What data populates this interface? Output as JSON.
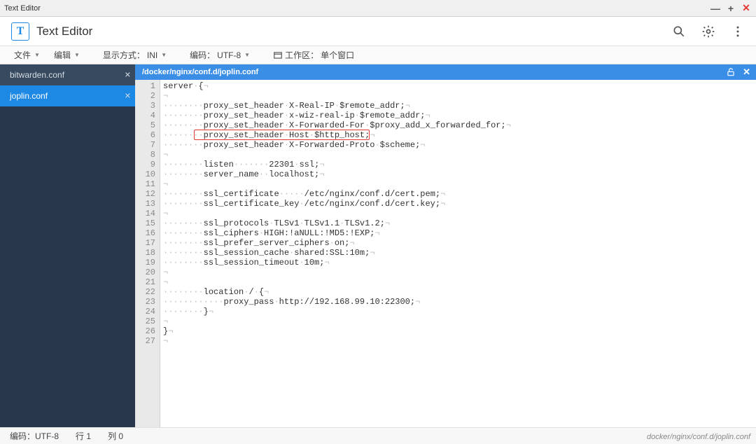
{
  "window": {
    "title": "Text Editor"
  },
  "app": {
    "title": "Text Editor",
    "logo_letter": "T"
  },
  "toolbar": {
    "file": "文件",
    "edit": "编辑",
    "view_label": "显示方式：",
    "view_value": "INI",
    "encoding_label": "编码：",
    "encoding_value": "UTF-8",
    "workspace_label": "工作区：",
    "workspace_value": "单个窗口"
  },
  "sidebar": {
    "tabs": [
      {
        "name": "bitwarden.conf",
        "active": false
      },
      {
        "name": "joplin.conf",
        "active": true
      }
    ]
  },
  "filebar": {
    "path": "/docker/nginx/conf.d/joplin.conf"
  },
  "code": {
    "lines": [
      "server {",
      "",
      "        proxy_set_header X-Real-IP $remote_addr;",
      "        proxy_set_header x-wiz-real-ip $remote_addr;",
      "        proxy_set_header X-Forwarded-For $proxy_add_x_forwarded_for;",
      "        proxy_set_header Host $http_host;",
      "        proxy_set_header X-Forwarded-Proto $scheme;",
      "",
      "        listen       22301 ssl;",
      "        server_name  localhost;",
      "",
      "        ssl_certificate     /etc/nginx/conf.d/cert.pem;",
      "        ssl_certificate_key /etc/nginx/conf.d/cert.key;",
      "",
      "        ssl_protocols TLSv1 TLSv1.1 TLSv1.2;",
      "        ssl_ciphers HIGH:!aNULL:!MD5:!EXP;",
      "        ssl_prefer_server_ciphers on;",
      "        ssl_session_cache shared:SSL:10m;",
      "        ssl_session_timeout 10m;",
      "",
      "",
      "        location / {",
      "            proxy_pass http://192.168.99.10:22300;",
      "        }",
      "",
      "}",
      ""
    ],
    "highlight_line": 6
  },
  "status": {
    "encoding_label": "编码：",
    "encoding_value": "UTF-8",
    "line_label": "行",
    "line_value": "1",
    "col_label": "列",
    "col_value": "0"
  },
  "watermark": "docker/nginx/conf.d/joplin.conf"
}
